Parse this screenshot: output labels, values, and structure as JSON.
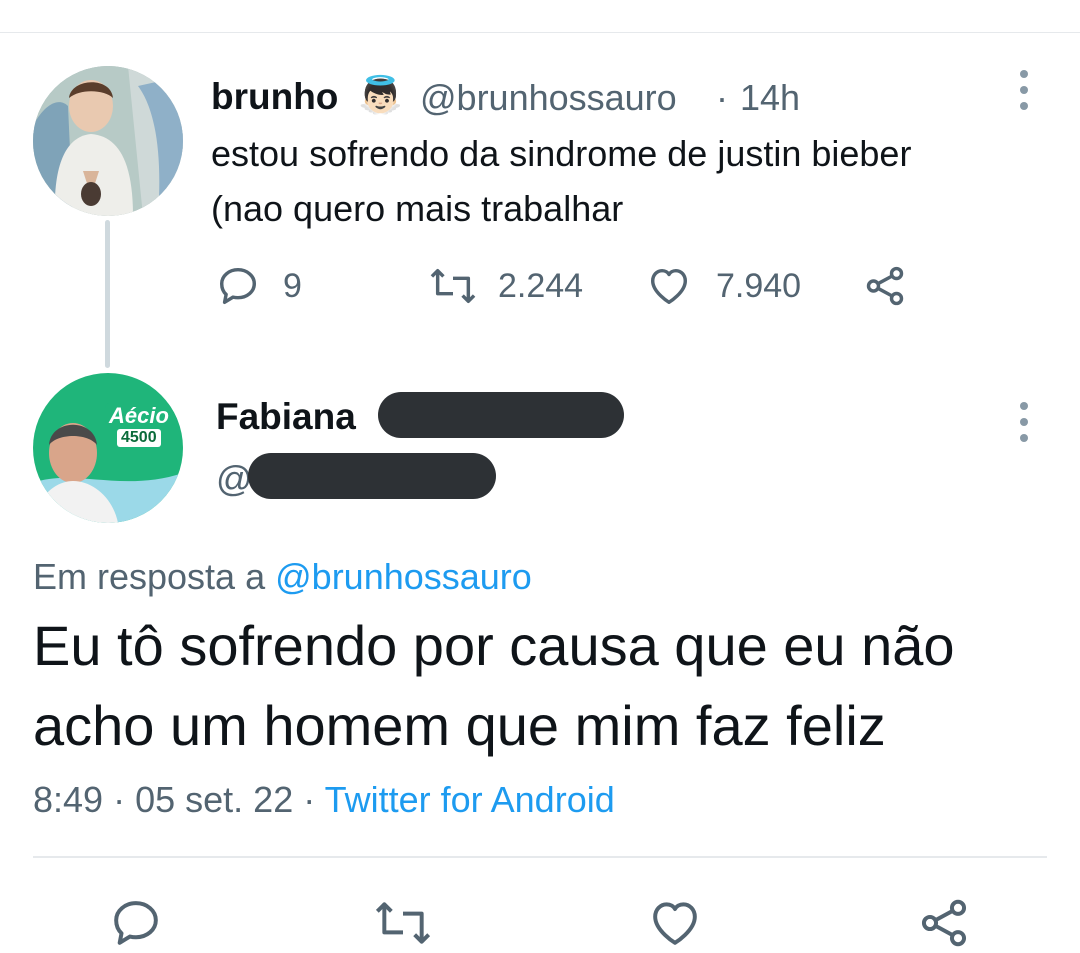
{
  "original_tweet": {
    "display_name": "brunho",
    "emoji_badge": "👼🏻",
    "handle": "@brunhossauro",
    "separator": "·",
    "time": "14h",
    "text_line1": "estou sofrendo da sindrome de justin bieber",
    "text_line2": "(nao quero mais trabalhar",
    "replies": "9",
    "retweets": "2.244",
    "likes": "7.940"
  },
  "reply_tweet": {
    "display_name": "Fabiana",
    "handle_prefix": "@",
    "avatar_sign_name": "Aécio",
    "avatar_sign_number": "4500",
    "reply_prefix": "Em resposta a",
    "reply_to": "@brunhossauro",
    "text_line1": "Eu tô sofrendo por causa que eu não",
    "text_line2": "acho um homem que mim faz feliz",
    "time": "8:49",
    "date": "05 set. 22",
    "separator": "·",
    "source": "Twitter for Android"
  },
  "icons": [
    "reply-icon",
    "retweet-icon",
    "like-icon",
    "share-icon",
    "more-icon"
  ],
  "colors": {
    "accent": "#1d9bf0",
    "secondary_text": "#536471",
    "text": "#0f1419"
  }
}
